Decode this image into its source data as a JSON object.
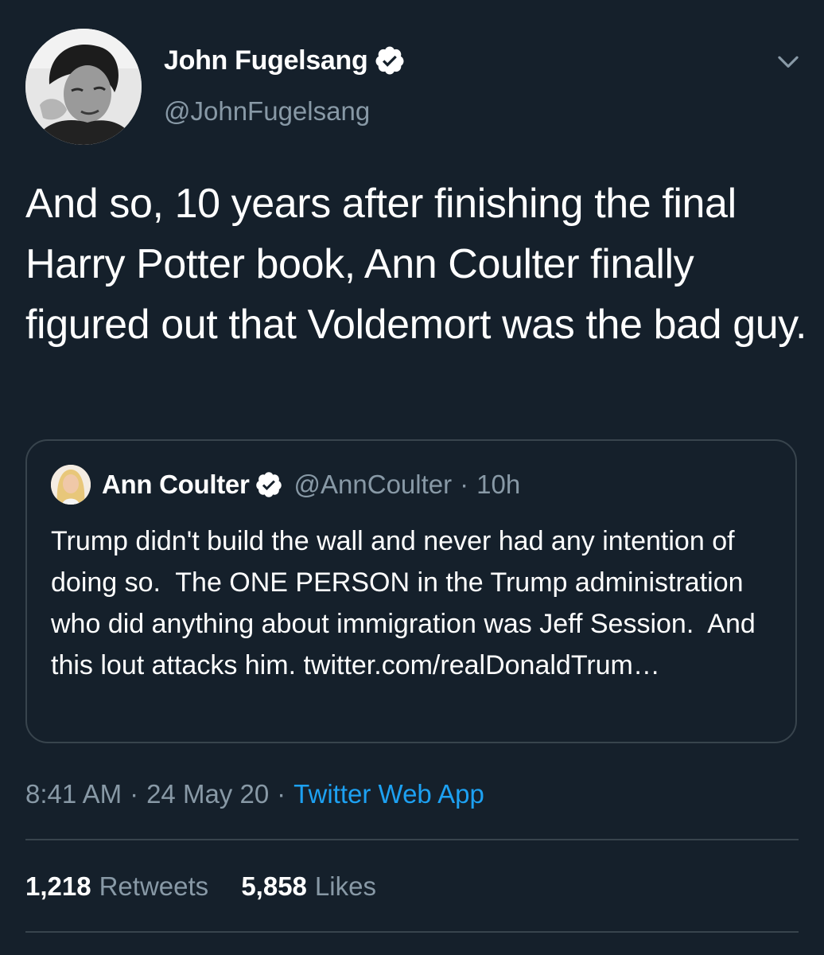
{
  "author": {
    "display_name": "John Fugelsang",
    "handle": "@JohnFugelsang",
    "verified": true,
    "avatar_icon": "author-avatar"
  },
  "tweet": {
    "text": "And so, 10 years after finishing the final Harry Potter book, Ann Coulter finally figured out that Voldemort was the bad guy."
  },
  "quoted": {
    "display_name": "Ann Coulter",
    "handle": "@AnnCoulter",
    "separator": "·",
    "time_ago": "10h",
    "verified": true,
    "text": "Trump didn't build the wall and never had any intention of doing so.  The ONE PERSON in the Trump administration who did anything about immigration was Jeff Session.  And this lout attacks him. twitter.com/realDonaldTrum…"
  },
  "meta": {
    "time": "8:41 AM",
    "date": "24 May 20",
    "separator": "·",
    "source": "Twitter Web App"
  },
  "stats": {
    "retweets_count": "1,218",
    "retweets_label": "Retweets",
    "likes_count": "5,858",
    "likes_label": "Likes"
  },
  "colors": {
    "background": "#15202b",
    "text": "#ffffff",
    "muted": "#8899a6",
    "link": "#1da1f2",
    "border": "#38444d"
  }
}
